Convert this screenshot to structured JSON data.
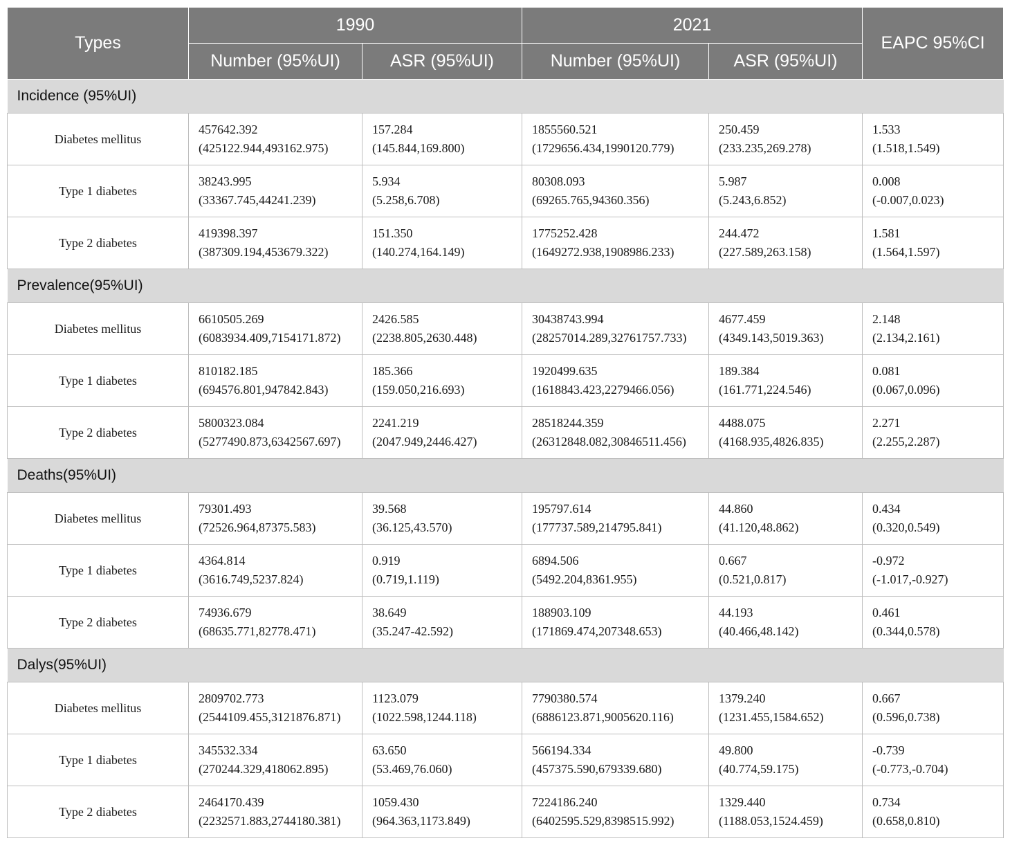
{
  "header": {
    "types": "Types",
    "year_1990": "1990",
    "year_2021": "2021",
    "eapc": "EAPC 95%CI",
    "number_1990": "Number (95%UI)",
    "asr_1990": "ASR (95%UI)",
    "number_2021": "Number (95%UI)",
    "asr_2021": "ASR (95%UI)"
  },
  "sections": [
    {
      "title": "Incidence (95%UI)",
      "rows": [
        {
          "type": "Diabetes mellitus",
          "n1990": "457642.392",
          "n1990_ci": "(425122.944,493162.975)",
          "a1990": "157.284",
          "a1990_ci": "(145.844,169.800)",
          "n2021": "1855560.521",
          "n2021_ci": "(1729656.434,1990120.779)",
          "a2021": "250.459",
          "a2021_ci": "(233.235,269.278)",
          "eapc": "1.533",
          "eapc_ci": "(1.518,1.549)"
        },
        {
          "type": "Type 1 diabetes",
          "n1990": "38243.995",
          "n1990_ci": "(33367.745,44241.239)",
          "a1990": "5.934",
          "a1990_ci": "(5.258,6.708)",
          "n2021": "80308.093",
          "n2021_ci": "(69265.765,94360.356)",
          "a2021": "5.987",
          "a2021_ci": "(5.243,6.852)",
          "eapc": "0.008",
          "eapc_ci": "(-0.007,0.023)"
        },
        {
          "type": "Type 2 diabetes",
          "n1990": "419398.397",
          "n1990_ci": "(387309.194,453679.322)",
          "a1990": "151.350",
          "a1990_ci": "(140.274,164.149)",
          "n2021": "1775252.428",
          "n2021_ci": "(1649272.938,1908986.233)",
          "a2021": "244.472",
          "a2021_ci": "(227.589,263.158)",
          "eapc": "1.581",
          "eapc_ci": "(1.564,1.597)"
        }
      ]
    },
    {
      "title": "Prevalence(95%UI)",
      "rows": [
        {
          "type": "Diabetes mellitus",
          "n1990": "6610505.269",
          "n1990_ci": "(6083934.409,7154171.872)",
          "a1990": "2426.585",
          "a1990_ci": "(2238.805,2630.448)",
          "n2021": "30438743.994",
          "n2021_ci": "(28257014.289,32761757.733)",
          "a2021": "4677.459",
          "a2021_ci": "(4349.143,5019.363)",
          "eapc": "2.148",
          "eapc_ci": "(2.134,2.161)"
        },
        {
          "type": "Type 1 diabetes",
          "n1990": "810182.185",
          "n1990_ci": "(694576.801,947842.843)",
          "a1990": "185.366",
          "a1990_ci": "(159.050,216.693)",
          "n2021": "1920499.635",
          "n2021_ci": "(1618843.423,2279466.056)",
          "a2021": "189.384",
          "a2021_ci": "(161.771,224.546)",
          "eapc": "0.081",
          "eapc_ci": "(0.067,0.096)"
        },
        {
          "type": "Type 2 diabetes",
          "n1990": "5800323.084",
          "n1990_ci": "(5277490.873,6342567.697)",
          "a1990": "2241.219",
          "a1990_ci": "(2047.949,2446.427)",
          "n2021": "28518244.359",
          "n2021_ci": "(26312848.082,30846511.456)",
          "a2021": "4488.075",
          "a2021_ci": "(4168.935,4826.835)",
          "eapc": "2.271",
          "eapc_ci": "(2.255,2.287)"
        }
      ]
    },
    {
      "title": "Deaths(95%UI)",
      "rows": [
        {
          "type": "Diabetes mellitus",
          "n1990": "79301.493",
          "n1990_ci": "(72526.964,87375.583)",
          "a1990": "39.568",
          "a1990_ci": "(36.125,43.570)",
          "n2021": "195797.614",
          "n2021_ci": "(177737.589,214795.841)",
          "a2021": "44.860",
          "a2021_ci": "(41.120,48.862)",
          "eapc": "0.434",
          "eapc_ci": "(0.320,0.549)"
        },
        {
          "type": "Type 1 diabetes",
          "n1990": "4364.814",
          "n1990_ci": "(3616.749,5237.824)",
          "a1990": "0.919",
          "a1990_ci": "(0.719,1.119)",
          "n2021": "6894.506",
          "n2021_ci": "(5492.204,8361.955)",
          "a2021": "0.667",
          "a2021_ci": "(0.521,0.817)",
          "eapc": "-0.972",
          "eapc_ci": "(-1.017,-0.927)"
        },
        {
          "type": "Type 2 diabetes",
          "n1990": "74936.679",
          "n1990_ci": "(68635.771,82778.471)",
          "a1990": "38.649",
          "a1990_ci": "(35.247-42.592)",
          "n2021": "188903.109",
          "n2021_ci": "(171869.474,207348.653)",
          "a2021": "44.193",
          "a2021_ci": "(40.466,48.142)",
          "eapc": "0.461",
          "eapc_ci": "(0.344,0.578)"
        }
      ]
    },
    {
      "title": "Dalys(95%UI)",
      "rows": [
        {
          "type": "Diabetes mellitus",
          "n1990": "2809702.773",
          "n1990_ci": "(2544109.455,3121876.871)",
          "a1990": "1123.079",
          "a1990_ci": "(1022.598,1244.118)",
          "n2021": "7790380.574",
          "n2021_ci": "(6886123.871,9005620.116)",
          "a2021": "1379.240",
          "a2021_ci": "(1231.455,1584.652)",
          "eapc": "0.667",
          "eapc_ci": "(0.596,0.738)"
        },
        {
          "type": "Type 1 diabetes",
          "n1990": "345532.334",
          "n1990_ci": "(270244.329,418062.895)",
          "a1990": "63.650",
          "a1990_ci": "(53.469,76.060)",
          "n2021": "566194.334",
          "n2021_ci": "(457375.590,679339.680)",
          "a2021": "49.800",
          "a2021_ci": "(40.774,59.175)",
          "eapc": "-0.739",
          "eapc_ci": "(-0.773,-0.704)"
        },
        {
          "type": "Type 2 diabetes",
          "n1990": "2464170.439",
          "n1990_ci": "(2232571.883,2744180.381)",
          "a1990": "1059.430",
          "a1990_ci": "(964.363,1173.849)",
          "n2021": "7224186.240",
          "n2021_ci": "(6402595.529,8398515.992)",
          "a2021": "1329.440",
          "a2021_ci": "(1188.053,1524.459)",
          "eapc": "0.734",
          "eapc_ci": "(0.658,0.810)"
        }
      ]
    }
  ]
}
